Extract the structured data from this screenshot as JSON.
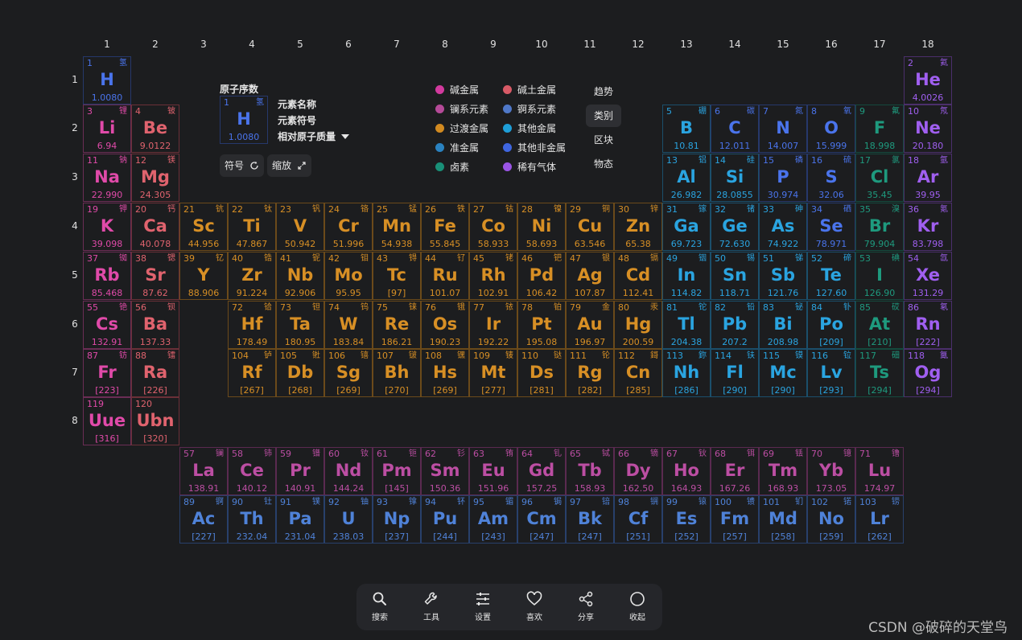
{
  "groups": [
    "1",
    "2",
    "3",
    "4",
    "5",
    "6",
    "7",
    "8",
    "9",
    "10",
    "11",
    "12",
    "13",
    "14",
    "15",
    "16",
    "17",
    "18"
  ],
  "periods": [
    "1",
    "2",
    "3",
    "4",
    "5",
    "6",
    "7",
    "8"
  ],
  "legend": {
    "title": "原子序数",
    "sample": {
      "n": "1",
      "c": "氢",
      "s": "H",
      "m": "1.0080"
    },
    "name_label": "元素名称",
    "symbol_label": "元素符号",
    "mass_label": "相对原子质量",
    "symbol_button": "符号",
    "zoom_button": "缩放"
  },
  "categories": [
    {
      "label": "碱金属",
      "color": "#d23a9e"
    },
    {
      "label": "碱土金属",
      "color": "#d85a66"
    },
    {
      "label": "镧系元素",
      "color": "#b54a98"
    },
    {
      "label": "锕系元素",
      "color": "#4f78c8"
    },
    {
      "label": "过渡金属",
      "color": "#d28a20"
    },
    {
      "label": "其他金属",
      "color": "#1e9ed8"
    },
    {
      "label": "准金属",
      "color": "#2a82c0"
    },
    {
      "label": "其他非金属",
      "color": "#3f66e0"
    },
    {
      "label": "卤素",
      "color": "#199078"
    },
    {
      "label": "稀有气体",
      "color": "#9a55e6"
    }
  ],
  "views": [
    "趋势",
    "类别",
    "区块",
    "物态"
  ],
  "active_view": "类别",
  "toolbar": [
    "搜索",
    "工具",
    "设置",
    "喜欢",
    "分享",
    "收起"
  ],
  "watermark": "CSDN @破碎的天堂鸟",
  "elements": [
    {
      "n": "1",
      "c": "氢",
      "s": "H",
      "m": "1.0080",
      "g": 1,
      "p": 1,
      "k": "nonmetal"
    },
    {
      "n": "2",
      "c": "氦",
      "s": "He",
      "m": "4.0026",
      "g": 18,
      "p": 1,
      "k": "noble"
    },
    {
      "n": "3",
      "c": "锂",
      "s": "Li",
      "m": "6.94",
      "g": 1,
      "p": 2,
      "k": "alkali"
    },
    {
      "n": "4",
      "c": "铍",
      "s": "Be",
      "m": "9.0122",
      "g": 2,
      "p": 2,
      "k": "alkaline"
    },
    {
      "n": "5",
      "c": "硼",
      "s": "B",
      "m": "10.81",
      "g": 13,
      "p": 2,
      "k": "metalloid"
    },
    {
      "n": "6",
      "c": "碳",
      "s": "C",
      "m": "12.011",
      "g": 14,
      "p": 2,
      "k": "nonmetal"
    },
    {
      "n": "7",
      "c": "氮",
      "s": "N",
      "m": "14.007",
      "g": 15,
      "p": 2,
      "k": "nonmetal"
    },
    {
      "n": "8",
      "c": "氧",
      "s": "O",
      "m": "15.999",
      "g": 16,
      "p": 2,
      "k": "nonmetal"
    },
    {
      "n": "9",
      "c": "氟",
      "s": "F",
      "m": "18.998",
      "g": 17,
      "p": 2,
      "k": "halogen"
    },
    {
      "n": "10",
      "c": "氖",
      "s": "Ne",
      "m": "20.180",
      "g": 18,
      "p": 2,
      "k": "noble"
    },
    {
      "n": "11",
      "c": "钠",
      "s": "Na",
      "m": "22.990",
      "g": 1,
      "p": 3,
      "k": "alkali"
    },
    {
      "n": "12",
      "c": "镁",
      "s": "Mg",
      "m": "24.305",
      "g": 2,
      "p": 3,
      "k": "alkaline"
    },
    {
      "n": "13",
      "c": "铝",
      "s": "Al",
      "m": "26.982",
      "g": 13,
      "p": 3,
      "k": "post"
    },
    {
      "n": "14",
      "c": "硅",
      "s": "Si",
      "m": "28.0855",
      "g": 14,
      "p": 3,
      "k": "metalloid"
    },
    {
      "n": "15",
      "c": "磷",
      "s": "P",
      "m": "30.974",
      "g": 15,
      "p": 3,
      "k": "nonmetal"
    },
    {
      "n": "16",
      "c": "硫",
      "s": "S",
      "m": "32.06",
      "g": 16,
      "p": 3,
      "k": "nonmetal"
    },
    {
      "n": "17",
      "c": "氯",
      "s": "Cl",
      "m": "35.45",
      "g": 17,
      "p": 3,
      "k": "halogen"
    },
    {
      "n": "18",
      "c": "氩",
      "s": "Ar",
      "m": "39.95",
      "g": 18,
      "p": 3,
      "k": "noble"
    },
    {
      "n": "19",
      "c": "钾",
      "s": "K",
      "m": "39.098",
      "g": 1,
      "p": 4,
      "k": "alkali"
    },
    {
      "n": "20",
      "c": "钙",
      "s": "Ca",
      "m": "40.078",
      "g": 2,
      "p": 4,
      "k": "alkaline"
    },
    {
      "n": "21",
      "c": "钪",
      "s": "Sc",
      "m": "44.956",
      "g": 3,
      "p": 4,
      "k": "transition"
    },
    {
      "n": "22",
      "c": "钛",
      "s": "Ti",
      "m": "47.867",
      "g": 4,
      "p": 4,
      "k": "transition"
    },
    {
      "n": "23",
      "c": "钒",
      "s": "V",
      "m": "50.942",
      "g": 5,
      "p": 4,
      "k": "transition"
    },
    {
      "n": "24",
      "c": "铬",
      "s": "Cr",
      "m": "51.996",
      "g": 6,
      "p": 4,
      "k": "transition"
    },
    {
      "n": "25",
      "c": "锰",
      "s": "Mn",
      "m": "54.938",
      "g": 7,
      "p": 4,
      "k": "transition"
    },
    {
      "n": "26",
      "c": "铁",
      "s": "Fe",
      "m": "55.845",
      "g": 8,
      "p": 4,
      "k": "transition"
    },
    {
      "n": "27",
      "c": "钴",
      "s": "Co",
      "m": "58.933",
      "g": 9,
      "p": 4,
      "k": "transition"
    },
    {
      "n": "28",
      "c": "镍",
      "s": "Ni",
      "m": "58.693",
      "g": 10,
      "p": 4,
      "k": "transition"
    },
    {
      "n": "29",
      "c": "铜",
      "s": "Cu",
      "m": "63.546",
      "g": 11,
      "p": 4,
      "k": "transition"
    },
    {
      "n": "30",
      "c": "锌",
      "s": "Zn",
      "m": "65.38",
      "g": 12,
      "p": 4,
      "k": "transition"
    },
    {
      "n": "31",
      "c": "镓",
      "s": "Ga",
      "m": "69.723",
      "g": 13,
      "p": 4,
      "k": "post"
    },
    {
      "n": "32",
      "c": "锗",
      "s": "Ge",
      "m": "72.630",
      "g": 14,
      "p": 4,
      "k": "metalloid"
    },
    {
      "n": "33",
      "c": "砷",
      "s": "As",
      "m": "74.922",
      "g": 15,
      "p": 4,
      "k": "metalloid"
    },
    {
      "n": "34",
      "c": "硒",
      "s": "Se",
      "m": "78.971",
      "g": 16,
      "p": 4,
      "k": "nonmetal"
    },
    {
      "n": "35",
      "c": "溴",
      "s": "Br",
      "m": "79.904",
      "g": 17,
      "p": 4,
      "k": "halogen"
    },
    {
      "n": "36",
      "c": "氪",
      "s": "Kr",
      "m": "83.798",
      "g": 18,
      "p": 4,
      "k": "noble"
    },
    {
      "n": "37",
      "c": "铷",
      "s": "Rb",
      "m": "85.468",
      "g": 1,
      "p": 5,
      "k": "alkali"
    },
    {
      "n": "38",
      "c": "锶",
      "s": "Sr",
      "m": "87.62",
      "g": 2,
      "p": 5,
      "k": "alkaline"
    },
    {
      "n": "39",
      "c": "钇",
      "s": "Y",
      "m": "88.906",
      "g": 3,
      "p": 5,
      "k": "transition"
    },
    {
      "n": "40",
      "c": "锆",
      "s": "Zr",
      "m": "91.224",
      "g": 4,
      "p": 5,
      "k": "transition"
    },
    {
      "n": "41",
      "c": "铌",
      "s": "Nb",
      "m": "92.906",
      "g": 5,
      "p": 5,
      "k": "transition"
    },
    {
      "n": "42",
      "c": "钼",
      "s": "Mo",
      "m": "95.95",
      "g": 6,
      "p": 5,
      "k": "transition"
    },
    {
      "n": "43",
      "c": "锝",
      "s": "Tc",
      "m": "[97]",
      "g": 7,
      "p": 5,
      "k": "transition"
    },
    {
      "n": "44",
      "c": "钌",
      "s": "Ru",
      "m": "101.07",
      "g": 8,
      "p": 5,
      "k": "transition"
    },
    {
      "n": "45",
      "c": "铑",
      "s": "Rh",
      "m": "102.91",
      "g": 9,
      "p": 5,
      "k": "transition"
    },
    {
      "n": "46",
      "c": "钯",
      "s": "Pd",
      "m": "106.42",
      "g": 10,
      "p": 5,
      "k": "transition"
    },
    {
      "n": "47",
      "c": "银",
      "s": "Ag",
      "m": "107.87",
      "g": 11,
      "p": 5,
      "k": "transition"
    },
    {
      "n": "48",
      "c": "镉",
      "s": "Cd",
      "m": "112.41",
      "g": 12,
      "p": 5,
      "k": "transition"
    },
    {
      "n": "49",
      "c": "铟",
      "s": "In",
      "m": "114.82",
      "g": 13,
      "p": 5,
      "k": "post"
    },
    {
      "n": "50",
      "c": "锡",
      "s": "Sn",
      "m": "118.71",
      "g": 14,
      "p": 5,
      "k": "post"
    },
    {
      "n": "51",
      "c": "锑",
      "s": "Sb",
      "m": "121.76",
      "g": 15,
      "p": 5,
      "k": "metalloid"
    },
    {
      "n": "52",
      "c": "碲",
      "s": "Te",
      "m": "127.60",
      "g": 16,
      "p": 5,
      "k": "metalloid"
    },
    {
      "n": "53",
      "c": "碘",
      "s": "I",
      "m": "126.90",
      "g": 17,
      "p": 5,
      "k": "halogen"
    },
    {
      "n": "54",
      "c": "氙",
      "s": "Xe",
      "m": "131.29",
      "g": 18,
      "p": 5,
      "k": "noble"
    },
    {
      "n": "55",
      "c": "铯",
      "s": "Cs",
      "m": "132.91",
      "g": 1,
      "p": 6,
      "k": "alkali"
    },
    {
      "n": "56",
      "c": "钡",
      "s": "Ba",
      "m": "137.33",
      "g": 2,
      "p": 6,
      "k": "alkaline"
    },
    {
      "n": "72",
      "c": "铪",
      "s": "Hf",
      "m": "178.49",
      "g": 4,
      "p": 6,
      "k": "transition"
    },
    {
      "n": "73",
      "c": "钽",
      "s": "Ta",
      "m": "180.95",
      "g": 5,
      "p": 6,
      "k": "transition"
    },
    {
      "n": "74",
      "c": "钨",
      "s": "W",
      "m": "183.84",
      "g": 6,
      "p": 6,
      "k": "transition"
    },
    {
      "n": "75",
      "c": "铼",
      "s": "Re",
      "m": "186.21",
      "g": 7,
      "p": 6,
      "k": "transition"
    },
    {
      "n": "76",
      "c": "锇",
      "s": "Os",
      "m": "190.23",
      "g": 8,
      "p": 6,
      "k": "transition"
    },
    {
      "n": "77",
      "c": "铱",
      "s": "Ir",
      "m": "192.22",
      "g": 9,
      "p": 6,
      "k": "transition"
    },
    {
      "n": "78",
      "c": "铂",
      "s": "Pt",
      "m": "195.08",
      "g": 10,
      "p": 6,
      "k": "transition"
    },
    {
      "n": "79",
      "c": "金",
      "s": "Au",
      "m": "196.97",
      "g": 11,
      "p": 6,
      "k": "transition"
    },
    {
      "n": "80",
      "c": "汞",
      "s": "Hg",
      "m": "200.59",
      "g": 12,
      "p": 6,
      "k": "transition"
    },
    {
      "n": "81",
      "c": "铊",
      "s": "Tl",
      "m": "204.38",
      "g": 13,
      "p": 6,
      "k": "post"
    },
    {
      "n": "82",
      "c": "铅",
      "s": "Pb",
      "m": "207.2",
      "g": 14,
      "p": 6,
      "k": "post"
    },
    {
      "n": "83",
      "c": "铋",
      "s": "Bi",
      "m": "208.98",
      "g": 15,
      "p": 6,
      "k": "post"
    },
    {
      "n": "84",
      "c": "钋",
      "s": "Po",
      "m": "[209]",
      "g": 16,
      "p": 6,
      "k": "post"
    },
    {
      "n": "85",
      "c": "砹",
      "s": "At",
      "m": "[210]",
      "g": 17,
      "p": 6,
      "k": "halogen"
    },
    {
      "n": "86",
      "c": "氡",
      "s": "Rn",
      "m": "[222]",
      "g": 18,
      "p": 6,
      "k": "noble"
    },
    {
      "n": "87",
      "c": "钫",
      "s": "Fr",
      "m": "[223]",
      "g": 1,
      "p": 7,
      "k": "alkali"
    },
    {
      "n": "88",
      "c": "镭",
      "s": "Ra",
      "m": "[226]",
      "g": 2,
      "p": 7,
      "k": "alkaline"
    },
    {
      "n": "104",
      "c": "𬬻",
      "s": "Rf",
      "m": "[267]",
      "g": 4,
      "p": 7,
      "k": "transition"
    },
    {
      "n": "105",
      "c": "𬭊",
      "s": "Db",
      "m": "[268]",
      "g": 5,
      "p": 7,
      "k": "transition"
    },
    {
      "n": "106",
      "c": "𬭳",
      "s": "Sg",
      "m": "[269]",
      "g": 6,
      "p": 7,
      "k": "transition"
    },
    {
      "n": "107",
      "c": "𬭛",
      "s": "Bh",
      "m": "[270]",
      "g": 7,
      "p": 7,
      "k": "transition"
    },
    {
      "n": "108",
      "c": "𬭶",
      "s": "Hs",
      "m": "[269]",
      "g": 8,
      "p": 7,
      "k": "transition"
    },
    {
      "n": "109",
      "c": "鿏",
      "s": "Mt",
      "m": "[277]",
      "g": 9,
      "p": 7,
      "k": "transition"
    },
    {
      "n": "110",
      "c": "𫟼",
      "s": "Ds",
      "m": "[281]",
      "g": 10,
      "p": 7,
      "k": "transition"
    },
    {
      "n": "111",
      "c": "𬬭",
      "s": "Rg",
      "m": "[282]",
      "g": 11,
      "p": 7,
      "k": "transition"
    },
    {
      "n": "112",
      "c": "鎶",
      "s": "Cn",
      "m": "[285]",
      "g": 12,
      "p": 7,
      "k": "transition"
    },
    {
      "n": "113",
      "c": "鉨",
      "s": "Nh",
      "m": "[286]",
      "g": 13,
      "p": 7,
      "k": "post"
    },
    {
      "n": "114",
      "c": "𫓧",
      "s": "Fl",
      "m": "[290]",
      "g": 14,
      "p": 7,
      "k": "post"
    },
    {
      "n": "115",
      "c": "镆",
      "s": "Mc",
      "m": "[290]",
      "g": 15,
      "p": 7,
      "k": "post"
    },
    {
      "n": "116",
      "c": "𫟷",
      "s": "Lv",
      "m": "[293]",
      "g": 16,
      "p": 7,
      "k": "post"
    },
    {
      "n": "117",
      "c": "鿬",
      "s": "Ts",
      "m": "[294]",
      "g": 17,
      "p": 7,
      "k": "halogen"
    },
    {
      "n": "118",
      "c": "鿫",
      "s": "Og",
      "m": "[294]",
      "g": 18,
      "p": 7,
      "k": "noble"
    },
    {
      "n": "119",
      "c": "",
      "s": "Uue",
      "m": "[316]",
      "g": 1,
      "p": 8,
      "k": "alkali"
    },
    {
      "n": "120",
      "c": "",
      "s": "Ubn",
      "m": "[320]",
      "g": 2,
      "p": 8,
      "k": "alkaline"
    },
    {
      "n": "57",
      "c": "镧",
      "s": "La",
      "m": "138.91",
      "g": 3,
      "p": 9,
      "k": "lanth"
    },
    {
      "n": "58",
      "c": "铈",
      "s": "Ce",
      "m": "140.12",
      "g": 4,
      "p": 9,
      "k": "lanth"
    },
    {
      "n": "59",
      "c": "镨",
      "s": "Pr",
      "m": "140.91",
      "g": 5,
      "p": 9,
      "k": "lanth"
    },
    {
      "n": "60",
      "c": "钕",
      "s": "Nd",
      "m": "144.24",
      "g": 6,
      "p": 9,
      "k": "lanth"
    },
    {
      "n": "61",
      "c": "钷",
      "s": "Pm",
      "m": "[145]",
      "g": 7,
      "p": 9,
      "k": "lanth"
    },
    {
      "n": "62",
      "c": "钐",
      "s": "Sm",
      "m": "150.36",
      "g": 8,
      "p": 9,
      "k": "lanth"
    },
    {
      "n": "63",
      "c": "铕",
      "s": "Eu",
      "m": "151.96",
      "g": 9,
      "p": 9,
      "k": "lanth"
    },
    {
      "n": "64",
      "c": "钆",
      "s": "Gd",
      "m": "157.25",
      "g": 10,
      "p": 9,
      "k": "lanth"
    },
    {
      "n": "65",
      "c": "铽",
      "s": "Tb",
      "m": "158.93",
      "g": 11,
      "p": 9,
      "k": "lanth"
    },
    {
      "n": "66",
      "c": "镝",
      "s": "Dy",
      "m": "162.50",
      "g": 12,
      "p": 9,
      "k": "lanth"
    },
    {
      "n": "67",
      "c": "钬",
      "s": "Ho",
      "m": "164.93",
      "g": 13,
      "p": 9,
      "k": "lanth"
    },
    {
      "n": "68",
      "c": "铒",
      "s": "Er",
      "m": "167.26",
      "g": 14,
      "p": 9,
      "k": "lanth"
    },
    {
      "n": "69",
      "c": "铥",
      "s": "Tm",
      "m": "168.93",
      "g": 15,
      "p": 9,
      "k": "lanth"
    },
    {
      "n": "70",
      "c": "镱",
      "s": "Yb",
      "m": "173.05",
      "g": 16,
      "p": 9,
      "k": "lanth"
    },
    {
      "n": "71",
      "c": "镥",
      "s": "Lu",
      "m": "174.97",
      "g": 17,
      "p": 9,
      "k": "lanth"
    },
    {
      "n": "89",
      "c": "锕",
      "s": "Ac",
      "m": "[227]",
      "g": 3,
      "p": 10,
      "k": "actin"
    },
    {
      "n": "90",
      "c": "钍",
      "s": "Th",
      "m": "232.04",
      "g": 4,
      "p": 10,
      "k": "actin"
    },
    {
      "n": "91",
      "c": "镤",
      "s": "Pa",
      "m": "231.04",
      "g": 5,
      "p": 10,
      "k": "actin"
    },
    {
      "n": "92",
      "c": "铀",
      "s": "U",
      "m": "238.03",
      "g": 6,
      "p": 10,
      "k": "actin"
    },
    {
      "n": "93",
      "c": "镎",
      "s": "Np",
      "m": "[237]",
      "g": 7,
      "p": 10,
      "k": "actin"
    },
    {
      "n": "94",
      "c": "钚",
      "s": "Pu",
      "m": "[244]",
      "g": 8,
      "p": 10,
      "k": "actin"
    },
    {
      "n": "95",
      "c": "镅",
      "s": "Am",
      "m": "[243]",
      "g": 9,
      "p": 10,
      "k": "actin"
    },
    {
      "n": "96",
      "c": "锔",
      "s": "Cm",
      "m": "[247]",
      "g": 10,
      "p": 10,
      "k": "actin"
    },
    {
      "n": "97",
      "c": "锫",
      "s": "Bk",
      "m": "[247]",
      "g": 11,
      "p": 10,
      "k": "actin"
    },
    {
      "n": "98",
      "c": "锎",
      "s": "Cf",
      "m": "[251]",
      "g": 12,
      "p": 10,
      "k": "actin"
    },
    {
      "n": "99",
      "c": "锿",
      "s": "Es",
      "m": "[252]",
      "g": 13,
      "p": 10,
      "k": "actin"
    },
    {
      "n": "100",
      "c": "镄",
      "s": "Fm",
      "m": "[257]",
      "g": 14,
      "p": 10,
      "k": "actin"
    },
    {
      "n": "101",
      "c": "钔",
      "s": "Md",
      "m": "[258]",
      "g": 15,
      "p": 10,
      "k": "actin"
    },
    {
      "n": "102",
      "c": "锘",
      "s": "No",
      "m": "[259]",
      "g": 16,
      "p": 10,
      "k": "actin"
    },
    {
      "n": "103",
      "c": "铹",
      "s": "Lr",
      "m": "[262]",
      "g": 17,
      "p": 10,
      "k": "actin"
    }
  ]
}
